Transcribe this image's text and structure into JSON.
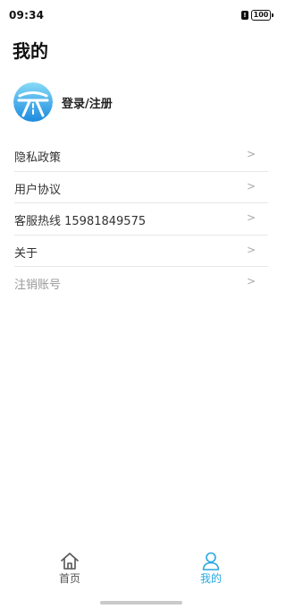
{
  "status_bar": {
    "time": "09:34",
    "alert_icon": "alert-icon",
    "battery": "100"
  },
  "page": {
    "title": "我的"
  },
  "profile": {
    "avatar_icon": "road-logo-icon",
    "login_label": "登录/注册"
  },
  "menu": {
    "items": [
      {
        "label": "隐私政策",
        "arrow": ">"
      },
      {
        "label": "用户协议",
        "arrow": ">"
      },
      {
        "label": "客服热线 15981849575",
        "arrow": ">"
      },
      {
        "label": "关于",
        "arrow": ">"
      },
      {
        "label": "注销账号",
        "arrow": ">"
      }
    ]
  },
  "tab_bar": {
    "tabs": [
      {
        "label": "首页",
        "icon": "home-icon"
      },
      {
        "label": "我的",
        "icon": "user-icon",
        "active": true
      }
    ]
  },
  "colors": {
    "accent": "#29a8e0",
    "avatar_gradient_top": "#7fd6f5",
    "avatar_gradient_bottom": "#1f8fe0"
  }
}
